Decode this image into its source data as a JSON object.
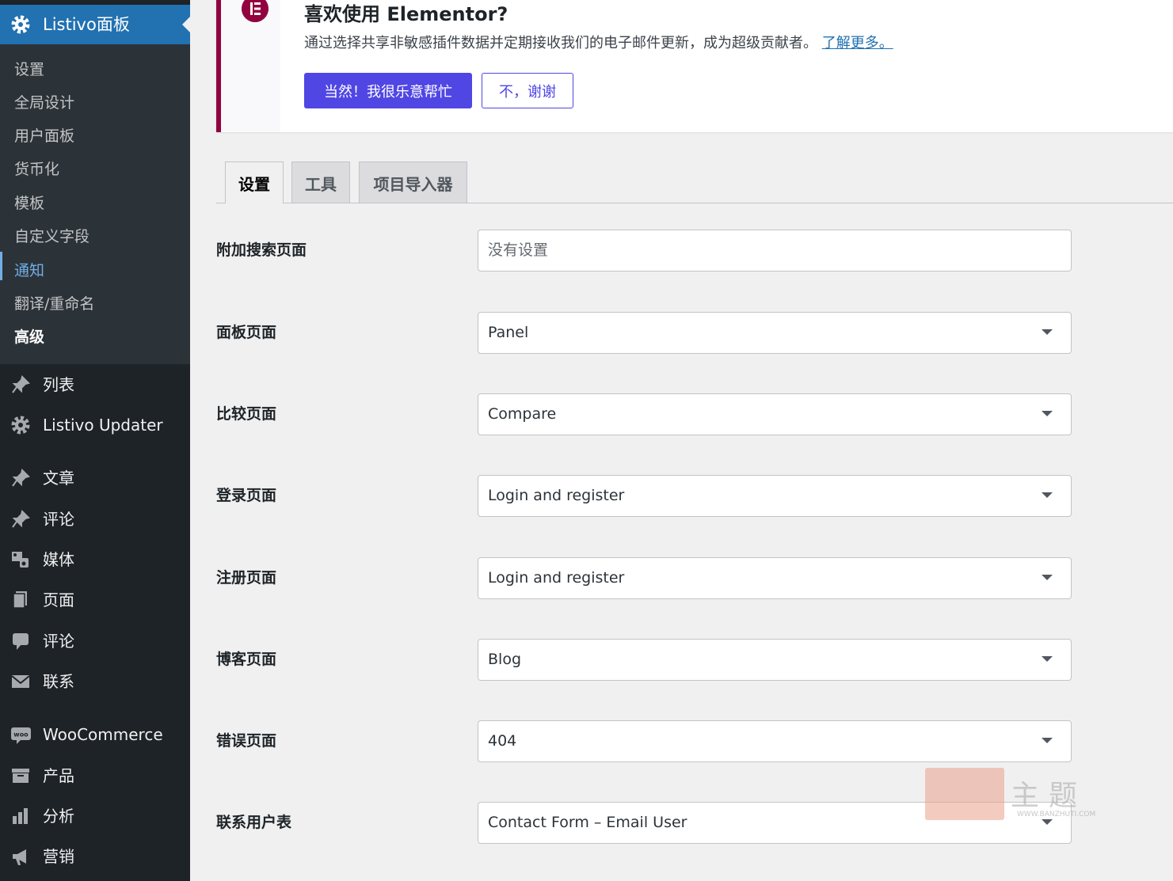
{
  "sidebar": {
    "active_menu_label": "Listivo面板",
    "submenu": [
      "设置",
      "全局设计",
      "用户面板",
      "货币化",
      "模板",
      "自定义字段",
      "通知",
      "翻译/重命名",
      "高级"
    ],
    "items": [
      {
        "label": "列表",
        "icon": "pin-icon"
      },
      {
        "label": "Listivo Updater",
        "icon": "gear-icon"
      },
      {
        "label": "文章",
        "icon": "pin-icon"
      },
      {
        "label": "评论",
        "icon": "pin-icon"
      },
      {
        "label": "媒体",
        "icon": "media-icon"
      },
      {
        "label": "页面",
        "icon": "page-icon"
      },
      {
        "label": "评论",
        "icon": "comment-icon"
      },
      {
        "label": "联系",
        "icon": "mail-icon"
      },
      {
        "label": "WooCommerce",
        "icon": "woo-icon"
      },
      {
        "label": "产品",
        "icon": "archive-icon"
      },
      {
        "label": "分析",
        "icon": "chart-icon"
      },
      {
        "label": "营销",
        "icon": "megaphone-icon"
      }
    ]
  },
  "notice": {
    "title": "喜欢使用 Elementor?",
    "description": "通过选择共享非敏感插件数据并定期接收我们的电子邮件更新，成为超级贡献者。",
    "learn_more": "了解更多。",
    "yes_button": "当然！我很乐意帮忙",
    "no_button": "不，谢谢"
  },
  "tabs": [
    "设置",
    "工具",
    "项目导入器"
  ],
  "fields": [
    {
      "label": "附加搜索页面",
      "value": "没有设置",
      "placeholder": true
    },
    {
      "label": "面板页面",
      "value": "Panel"
    },
    {
      "label": "比较页面",
      "value": "Compare"
    },
    {
      "label": "登录页面",
      "value": "Login and register"
    },
    {
      "label": "注册页面",
      "value": "Login and register"
    },
    {
      "label": "博客页面",
      "value": "Blog"
    },
    {
      "label": "错误页面",
      "value": "404"
    },
    {
      "label": "联系用户表",
      "value": "Contact Form – Email User"
    }
  ],
  "watermark": {
    "text": "主题",
    "url": "WWW.BANZHUTI.COM"
  },
  "colors": {
    "sidebar": "#1d2327",
    "active": "#2271b1",
    "elementor": "#93003f",
    "button": "#5046e4"
  }
}
